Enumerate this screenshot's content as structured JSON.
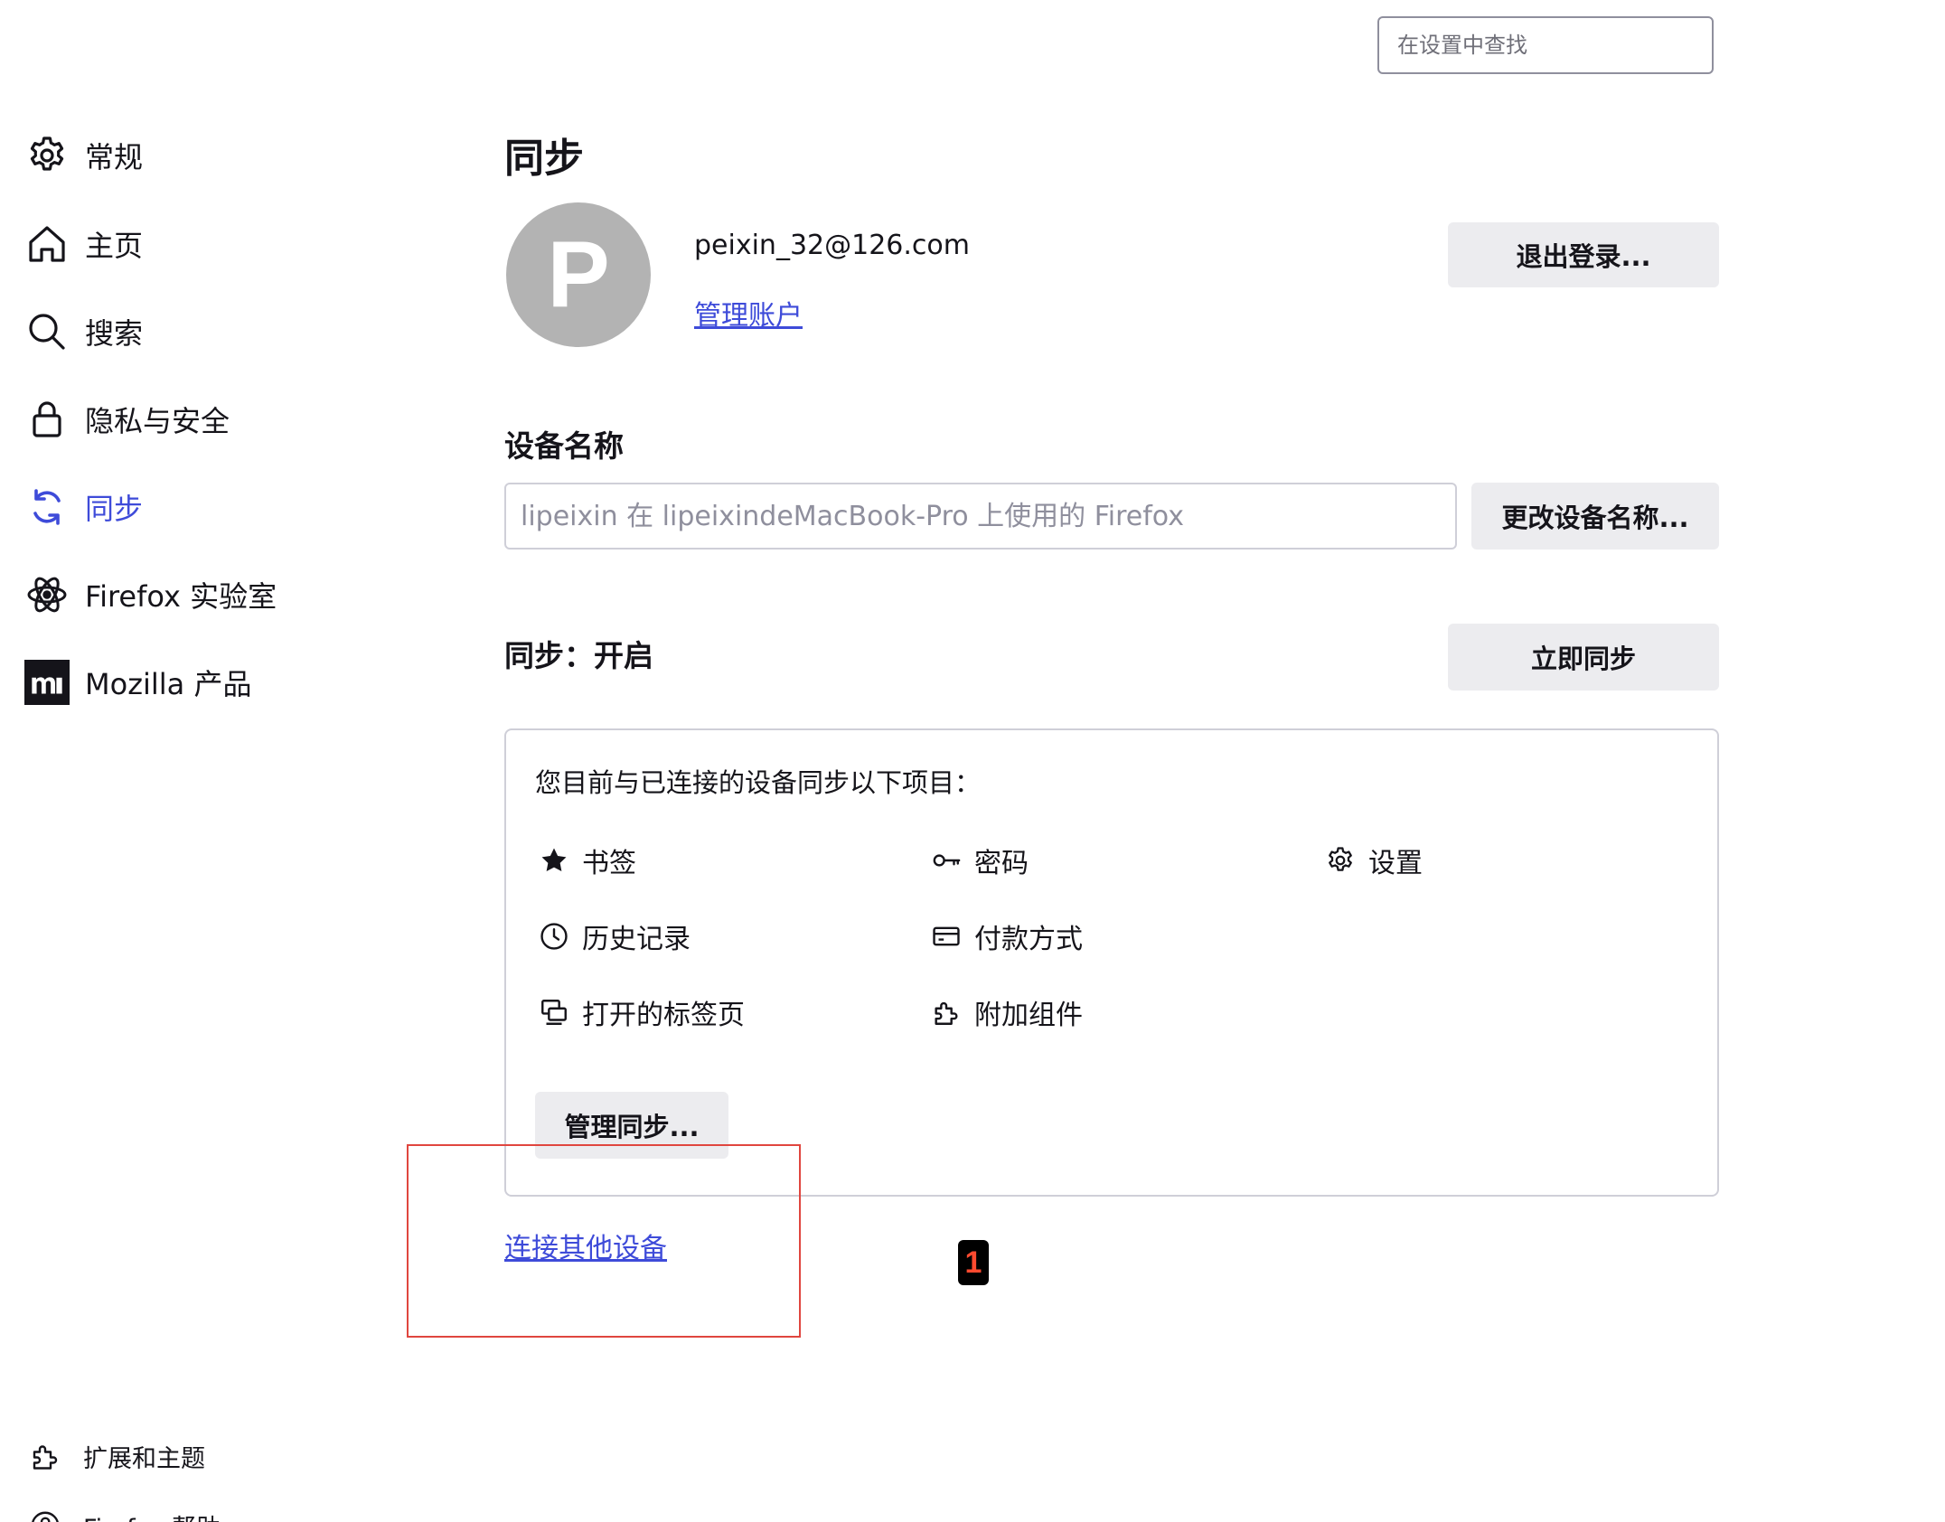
{
  "search": {
    "placeholder": "在设置中查找"
  },
  "sidebar": {
    "items": [
      {
        "label": "常规",
        "icon": "gear-icon",
        "active": false
      },
      {
        "label": "主页",
        "icon": "home-icon",
        "active": false
      },
      {
        "label": "搜索",
        "icon": "search-icon",
        "active": false
      },
      {
        "label": "隐私与安全",
        "icon": "lock-icon",
        "active": false
      },
      {
        "label": "同步",
        "icon": "sync-icon",
        "active": true
      },
      {
        "label": "Firefox 实验室",
        "icon": "labs-icon",
        "active": false
      },
      {
        "label": "Mozilla 产品",
        "icon": "mozilla-icon",
        "active": false
      }
    ],
    "footer": [
      {
        "label": "扩展和主题",
        "icon": "puzzle-icon"
      },
      {
        "label": "Firefox 帮助",
        "icon": "help-icon"
      }
    ]
  },
  "main": {
    "title": "同步",
    "account": {
      "avatar_letter": "P",
      "email": "peixin_32@126.com",
      "manage_link": "管理账户",
      "sign_out_button": "退出登录..."
    },
    "device": {
      "section_title": "设备名称",
      "field_value": "lipeixin 在 lipeixindeMacBook-Pro 上使用的 Firefox",
      "change_button": "更改设备名称..."
    },
    "sync_status": {
      "title": "同步：开启",
      "sync_now_button": "立即同步"
    },
    "sync_card": {
      "description": "您目前与已连接的设备同步以下项目：",
      "engines": [
        {
          "label": "书签",
          "icon": "star-icon"
        },
        {
          "label": "密码",
          "icon": "key-icon"
        },
        {
          "label": "设置",
          "icon": "gear-icon"
        },
        {
          "label": "历史记录",
          "icon": "clock-icon"
        },
        {
          "label": "付款方式",
          "icon": "credit-card-icon"
        },
        {
          "label": "打开的标签页",
          "icon": "tabs-icon"
        },
        {
          "label": "附加组件",
          "icon": "puzzle-icon"
        }
      ],
      "manage_button": "管理同步..."
    },
    "connect_link": "连接其他设备"
  },
  "annotation": {
    "badge": "1",
    "box_color": "#e0463f",
    "badge_text_color": "#ff4a2f"
  },
  "colors": {
    "accent": "#3e4bd9",
    "text": "#15141a",
    "button_bg": "#ececef",
    "border": "#cfcfd8"
  }
}
